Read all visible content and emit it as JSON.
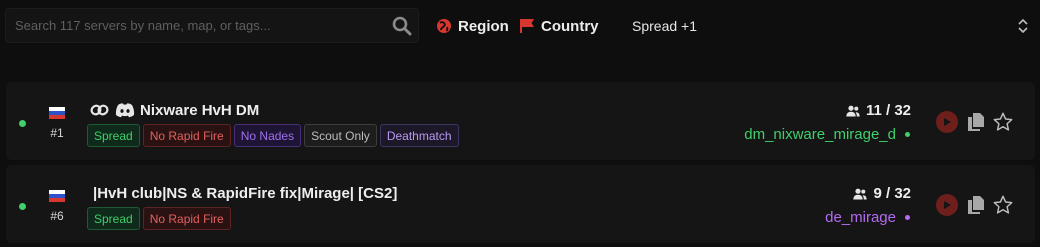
{
  "search": {
    "placeholder": "Search 117 servers by name, map, or tags..."
  },
  "filters": {
    "region_label": "Region",
    "country_label": "Country"
  },
  "spread_select": {
    "value": "Spread +1"
  },
  "colors": {
    "online": "#3fcf6b",
    "play": "#6e1f1c",
    "map_green": "#3fcf6b",
    "map_purple": "#b36bf2"
  },
  "servers": [
    {
      "rank": "#1",
      "name": "Nixware HvH DM",
      "tags": [
        "Spread",
        "No Rapid Fire",
        "No Nades",
        "Scout Only",
        "Deathmatch"
      ],
      "players": "11 / 32",
      "map": "dm_nixware_mirage_d"
    },
    {
      "rank": "#6",
      "name": "|HvH club|NS & RapidFire fix|Mirage| [CS2]",
      "tags": [
        "Spread",
        "No Rapid Fire"
      ],
      "players": "9 / 32",
      "map": "de_mirage"
    }
  ]
}
